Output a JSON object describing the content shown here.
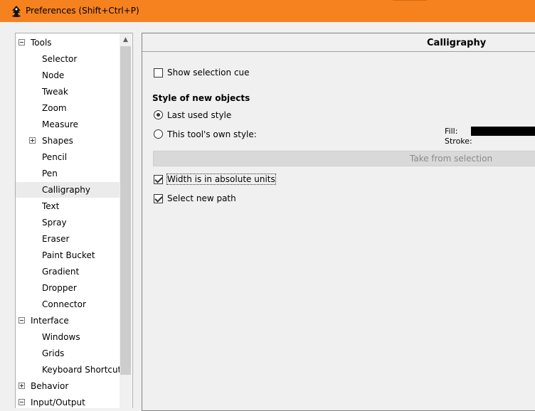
{
  "window": {
    "title": "Preferences (Shift+Ctrl+P)",
    "titlebar_color": "#f5821f",
    "icon": "inkscape-logo-icon"
  },
  "tree": {
    "items": [
      {
        "label": "Tools",
        "level": 0,
        "expander": "minus"
      },
      {
        "label": "Selector",
        "level": 1
      },
      {
        "label": "Node",
        "level": 1
      },
      {
        "label": "Tweak",
        "level": 1
      },
      {
        "label": "Zoom",
        "level": 1
      },
      {
        "label": "Measure",
        "level": 1
      },
      {
        "label": "Shapes",
        "level": 1,
        "expander": "plus"
      },
      {
        "label": "Pencil",
        "level": 1
      },
      {
        "label": "Pen",
        "level": 1
      },
      {
        "label": "Calligraphy",
        "level": 1,
        "selected": true
      },
      {
        "label": "Text",
        "level": 1
      },
      {
        "label": "Spray",
        "level": 1
      },
      {
        "label": "Eraser",
        "level": 1
      },
      {
        "label": "Paint Bucket",
        "level": 1
      },
      {
        "label": "Gradient",
        "level": 1
      },
      {
        "label": "Dropper",
        "level": 1
      },
      {
        "label": "Connector",
        "level": 1
      },
      {
        "label": "Interface",
        "level": 0,
        "expander": "minus"
      },
      {
        "label": "Windows",
        "level": 1
      },
      {
        "label": "Grids",
        "level": 1
      },
      {
        "label": "Keyboard Shortcuts",
        "level": 1
      },
      {
        "label": "Behavior",
        "level": 0,
        "expander": "plus"
      },
      {
        "label": "Input/Output",
        "level": 0,
        "expander": "minus"
      }
    ]
  },
  "panel": {
    "title": "Calligraphy",
    "show_selection_cue": {
      "label": "Show selection cue",
      "checked": false
    },
    "style_section_title": "Style of new objects",
    "style_options": [
      {
        "label": "Last used style",
        "checked": true
      },
      {
        "label": "This tool's own style:",
        "checked": false
      }
    ],
    "fill_label": "Fill:",
    "stroke_label": "Stroke:",
    "fill_color": "#000000",
    "take_from_selection_label": "Take from selection",
    "width_absolute": {
      "label": "Width is in absolute units",
      "checked": true
    },
    "select_new_path": {
      "label": "Select new path",
      "checked": true
    }
  }
}
